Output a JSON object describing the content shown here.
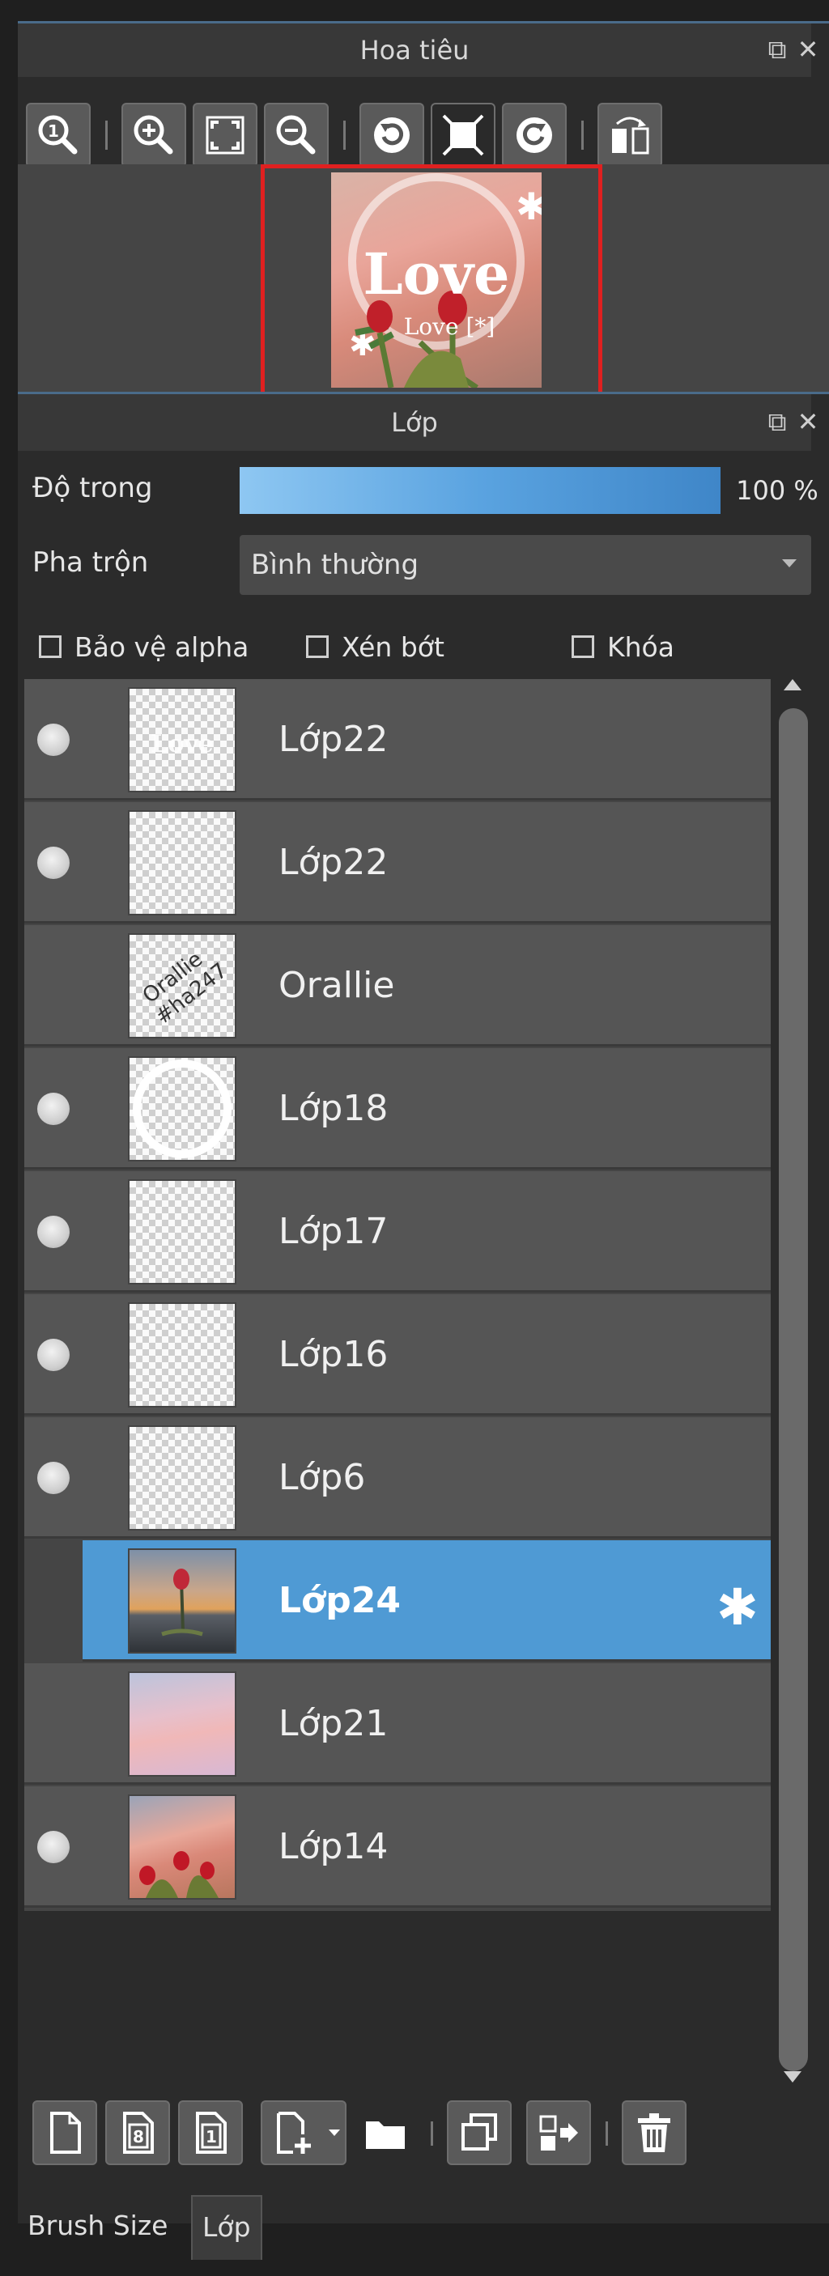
{
  "navigator": {
    "title": "Hoa tiêu",
    "toolbar_icons": [
      "zoom-actual-icon",
      "zoom-in-icon",
      "fit-screen-icon",
      "zoom-out-icon",
      "rotate-left-icon",
      "fill-frame-icon",
      "rotate-right-icon",
      "flip-icon"
    ],
    "preview_text_big": "Love",
    "preview_text_small": "Love [*]"
  },
  "layers_panel": {
    "title": "Lớp",
    "opacity_label": "Độ trong",
    "opacity_value": "100 %",
    "opacity_level": 1.0,
    "blend_label": "Pha trộn",
    "blend_value": "Bình thường",
    "checkbox_protect_alpha": "Bảo vệ alpha",
    "checkbox_clipping": "Xén bớt",
    "checkbox_lock": "Khóa",
    "layers": [
      {
        "name": "Lớp22",
        "visible": true,
        "thumb": "white-text"
      },
      {
        "name": "Lớp22",
        "visible": true,
        "thumb": "empty"
      },
      {
        "name": "Orallie",
        "visible": false,
        "thumb": "text"
      },
      {
        "name": "Lớp18",
        "visible": true,
        "thumb": "circle"
      },
      {
        "name": "Lớp17",
        "visible": true,
        "thumb": "empty"
      },
      {
        "name": "Lớp16",
        "visible": true,
        "thumb": "empty"
      },
      {
        "name": "Lớp6",
        "visible": true,
        "thumb": "empty"
      },
      {
        "name": "Lớp24",
        "visible": false,
        "thumb": "photo-sunset",
        "selected": true
      },
      {
        "name": "Lớp21",
        "visible": false,
        "thumb": "photo-sky"
      },
      {
        "name": "Lớp14",
        "visible": true,
        "thumb": "photo-tulips"
      }
    ],
    "thumb_text_orallie": "Orallie",
    "thumb_text_tag": "#ha247",
    "bottom_icons": [
      "new-layer-icon",
      "new-8bit-layer-icon",
      "new-1bit-layer-icon",
      "add-layer-menu-icon",
      "new-folder-icon",
      "duplicate-layer-icon",
      "merge-down-icon",
      "delete-layer-icon"
    ]
  },
  "tabs": [
    "Brush Size",
    "Lớp"
  ],
  "colors": {
    "accent_blue": "#4f9ad4",
    "preview_border": "#e02020",
    "panel_bg": "#2b2b2b"
  }
}
